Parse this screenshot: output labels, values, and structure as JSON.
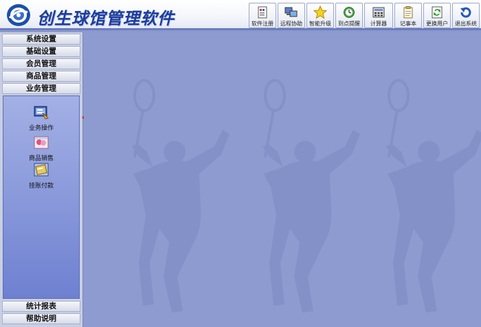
{
  "app": {
    "title": "创生球馆管理软件"
  },
  "toolbar": {
    "buttons": [
      {
        "label": "软件注册",
        "icon": "register-icon"
      },
      {
        "label": "远程协助",
        "icon": "remote-assist-icon"
      },
      {
        "label": "智能升级",
        "icon": "star-upgrade-icon"
      },
      {
        "label": "到点提醒",
        "icon": "alarm-clock-icon"
      },
      {
        "label": "计算器",
        "icon": "calculator-icon"
      },
      {
        "label": "记事本",
        "icon": "notepad-icon"
      },
      {
        "label": "更换用户",
        "icon": "switch-user-icon"
      },
      {
        "label": "退出系统",
        "icon": "exit-icon"
      }
    ]
  },
  "sidebar": {
    "menu_top": [
      {
        "label": "系统设置"
      },
      {
        "label": "基础设置"
      },
      {
        "label": "会员管理"
      },
      {
        "label": "商品管理"
      },
      {
        "label": "业务管理"
      }
    ],
    "panel_items": [
      {
        "label": "业务操作",
        "icon": "business-operation-icon"
      },
      {
        "label": "商品销售",
        "icon": "goods-sales-icon"
      },
      {
        "label": "挂账付款",
        "icon": "credit-payment-icon"
      }
    ],
    "menu_bottom": [
      {
        "label": "统计报表"
      },
      {
        "label": "帮助说明"
      }
    ]
  },
  "colors": {
    "background": "#8e9bd0",
    "title_blue": "#1d3d9c",
    "panel_blue": "#8a99da"
  }
}
